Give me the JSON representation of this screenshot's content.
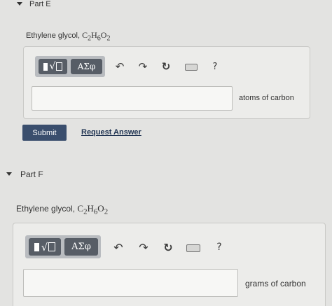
{
  "part_e": {
    "title": "Part E",
    "compound_name": "Ethylene glycol,",
    "formula": "C2H6O2",
    "toolbar": {
      "templates_label": "√",
      "greek_label": "ΑΣφ",
      "undo_icon": "undo-arrow",
      "redo_icon": "redo-arrow",
      "reset_icon": "refresh",
      "keyboard_icon": "keyboard",
      "help_label": "?"
    },
    "answer_value": "",
    "unit_label": "atoms of carbon",
    "submit_label": "Submit",
    "request_answer_label": "Request Answer"
  },
  "part_f": {
    "title": "Part F",
    "compound_name": "Ethylene glycol,",
    "formula": "C2H6O2",
    "toolbar": {
      "templates_label": "√",
      "greek_label": "ΑΣφ",
      "undo_icon": "undo-arrow",
      "redo_icon": "redo-arrow",
      "reset_icon": "refresh",
      "keyboard_icon": "keyboard",
      "help_label": "?"
    },
    "answer_value": "",
    "unit_label": "grams of carbon"
  },
  "colors": {
    "background": "#e3e3e1",
    "toolbar_dark": "#575d66",
    "submit_bg": "#3a4e6d",
    "link": "#213553"
  }
}
